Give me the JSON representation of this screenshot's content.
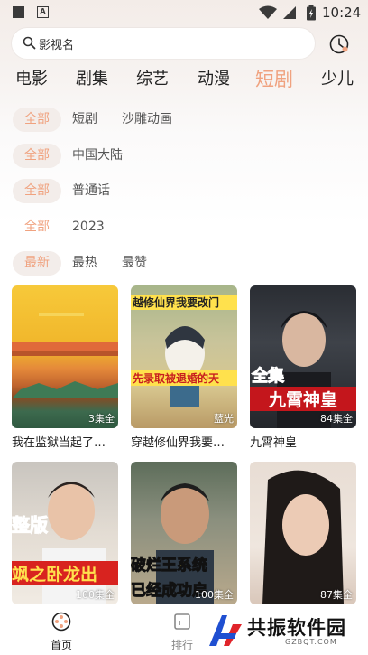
{
  "status_bar": {
    "time": "10:24",
    "notif_letter": "A"
  },
  "search": {
    "placeholder": "影视名"
  },
  "top_tabs": [
    "电影",
    "剧集",
    "综艺",
    "动漫",
    "短剧",
    "少儿"
  ],
  "active_tab": "短剧",
  "filters": [
    {
      "selected": "全部",
      "options": [
        "短剧",
        "沙雕动画"
      ]
    },
    {
      "selected": "全部",
      "options": [
        "中国大陆"
      ]
    },
    {
      "selected": "全部",
      "options": [
        "普通话"
      ]
    },
    {
      "selected": "全部",
      "options": [
        "2023"
      ]
    },
    {
      "selected": "最新",
      "options": [
        "最热",
        "最赞"
      ]
    }
  ],
  "cards": [
    {
      "title": "我在监狱当起了…",
      "badge": "3集全",
      "poster_text": ""
    },
    {
      "title": "穿越修仙界我要…",
      "badge": "蓝光",
      "poster_text_top": "越修仙界我要改门",
      "poster_text_bottom": "先录取被退婚的天"
    },
    {
      "title": "九霄神皇",
      "badge": "84集全",
      "poster_text_top": "全集",
      "poster_text_bottom": "九霄神皇"
    },
    {
      "title": "",
      "badge": "100集全",
      "poster_text_top": "整版",
      "poster_text_bottom": "飒之卧龙出"
    },
    {
      "title": "",
      "badge": "100集全",
      "poster_text_top": "破烂王系统",
      "poster_text_bottom": "已经成功启"
    },
    {
      "title": "",
      "badge": "87集全"
    }
  ],
  "bottom_nav": [
    {
      "label": "首页",
      "icon": "film-reel-icon"
    },
    {
      "label": "排行",
      "icon": "chart-icon"
    }
  ],
  "watermark": {
    "text": "共振软件园",
    "sub": "GZBQT.COM"
  },
  "colors": {
    "accent": "#f0a27f",
    "chip_bg": "#f3edea"
  }
}
